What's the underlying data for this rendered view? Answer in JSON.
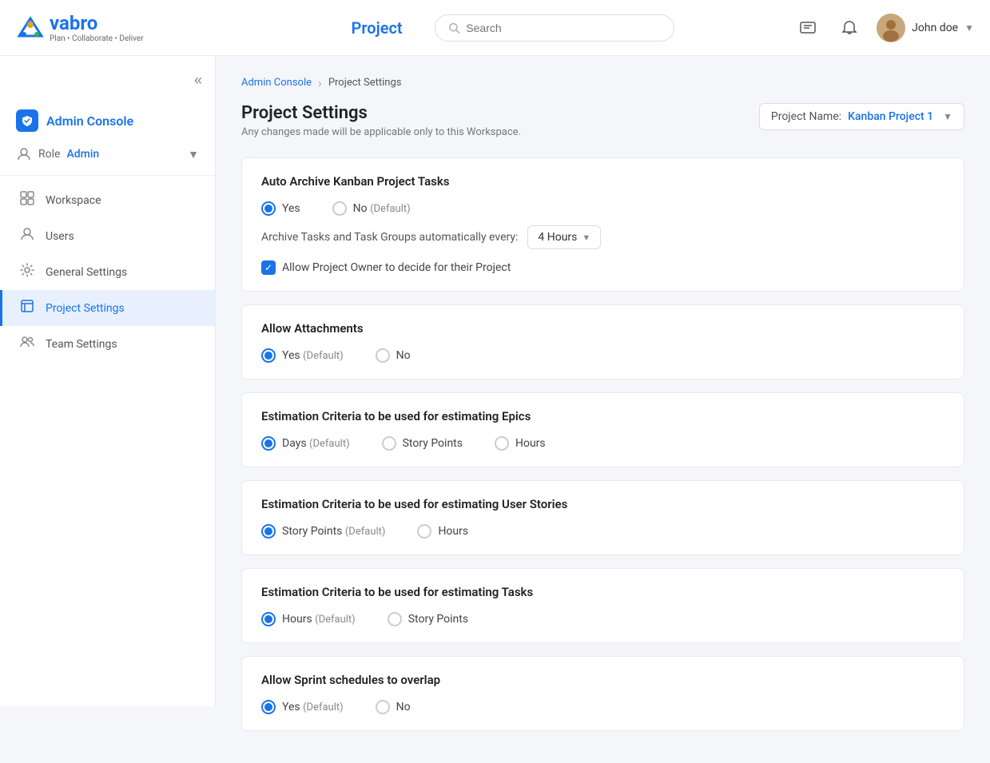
{
  "app": {
    "name": "vabro",
    "tagline": "Plan • Collaborate • Deliver"
  },
  "topnav": {
    "title": "Project",
    "search_placeholder": "Search",
    "user_name": "John doe"
  },
  "sidebar": {
    "collapse_icon": "«",
    "admin_console_label": "Admin Console",
    "role_label": "Role",
    "role_value": "Admin",
    "nav_items": [
      {
        "id": "workspace",
        "label": "Workspace",
        "active": false
      },
      {
        "id": "users",
        "label": "Users",
        "active": false
      },
      {
        "id": "general-settings",
        "label": "General Settings",
        "active": false
      },
      {
        "id": "project-settings",
        "label": "Project Settings",
        "active": true
      },
      {
        "id": "team-settings",
        "label": "Team Settings",
        "active": false
      }
    ]
  },
  "breadcrumb": {
    "parent": "Admin Console",
    "current": "Project Settings"
  },
  "page": {
    "title": "Project Settings",
    "subtitle": "Any changes made will be applicable only to this Workspace.",
    "project_name_label": "Project Name:",
    "project_name_value": "Kanban Project 1"
  },
  "cards": [
    {
      "id": "auto-archive",
      "title": "Auto Archive Kanban Project Tasks",
      "options": [
        {
          "label": "Yes",
          "default_label": "",
          "selected": true
        },
        {
          "label": "No",
          "default_label": "(Default)",
          "selected": false
        }
      ],
      "archive_label": "Archive Tasks and Task Groups automatically every:",
      "archive_interval": "4 Hours",
      "checkbox_label": "Allow Project Owner to decide for their Project",
      "checkbox_checked": true
    },
    {
      "id": "allow-attachments",
      "title": "Allow Attachments",
      "options": [
        {
          "label": "Yes",
          "default_label": "(Default)",
          "selected": true
        },
        {
          "label": "No",
          "default_label": "",
          "selected": false
        }
      ]
    },
    {
      "id": "estimation-epics",
      "title": "Estimation Criteria to be used for estimating Epics",
      "options": [
        {
          "label": "Days",
          "default_label": "(Default)",
          "selected": true
        },
        {
          "label": "Story Points",
          "default_label": "",
          "selected": false
        },
        {
          "label": "Hours",
          "default_label": "",
          "selected": false
        }
      ]
    },
    {
      "id": "estimation-stories",
      "title": "Estimation Criteria to be used for estimating User Stories",
      "options": [
        {
          "label": "Story Points",
          "default_label": "(Default)",
          "selected": true
        },
        {
          "label": "Hours",
          "default_label": "",
          "selected": false
        }
      ]
    },
    {
      "id": "estimation-tasks",
      "title": "Estimation Criteria to be used for estimating Tasks",
      "options": [
        {
          "label": "Hours",
          "default_label": "(Default)",
          "selected": true
        },
        {
          "label": "Story Points",
          "default_label": "",
          "selected": false
        }
      ]
    },
    {
      "id": "sprint-overlap",
      "title": "Allow Sprint schedules to overlap",
      "options": [
        {
          "label": "Yes",
          "default_label": "(Default)",
          "selected": true
        },
        {
          "label": "No",
          "default_label": "",
          "selected": false
        }
      ]
    }
  ]
}
